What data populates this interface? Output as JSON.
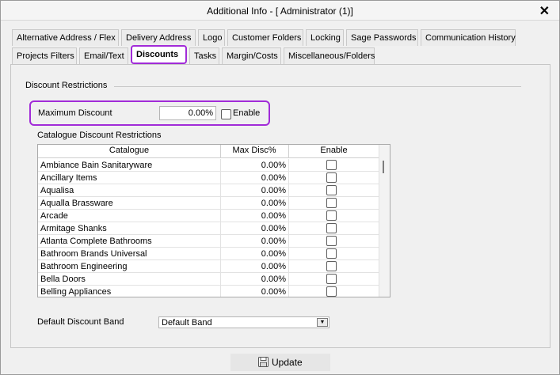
{
  "window": {
    "title": "Additional Info - [ Administrator (1)]",
    "close_glyph": "✕"
  },
  "tabs": {
    "row1": [
      "Alternative Address / Flex",
      "Delivery Address",
      "Logo",
      "Customer Folders",
      "Locking",
      "Sage Passwords",
      "Communication History"
    ],
    "row2": [
      "Projects Filters",
      "Email/Text",
      "Discounts",
      "Tasks",
      "Margin/Costs",
      "Miscellaneous/Folders"
    ],
    "active": "Discounts"
  },
  "discount_restrictions": {
    "group_label": "Discount Restrictions",
    "max_discount_label": "Maximum Discount",
    "max_discount_value": "0.00%",
    "enable_label": "Enable",
    "enable_checked": false
  },
  "catalogue": {
    "label": "Catalogue Discount Restrictions",
    "columns": [
      "Catalogue",
      "Max Disc%",
      "Enable"
    ],
    "rows": [
      {
        "name": "Ambiance Bain Sanitaryware",
        "disc": "0.00%",
        "enabled": false
      },
      {
        "name": "Ancillary Items",
        "disc": "0.00%",
        "enabled": false
      },
      {
        "name": "Aqualisa",
        "disc": "0.00%",
        "enabled": false
      },
      {
        "name": "Aqualla Brassware",
        "disc": "0.00%",
        "enabled": false
      },
      {
        "name": "Arcade",
        "disc": "0.00%",
        "enabled": false
      },
      {
        "name": "Armitage Shanks",
        "disc": "0.00%",
        "enabled": false
      },
      {
        "name": "Atlanta Complete Bathrooms",
        "disc": "0.00%",
        "enabled": false
      },
      {
        "name": "Bathroom Brands Universal",
        "disc": "0.00%",
        "enabled": false
      },
      {
        "name": "Bathroom Engineering",
        "disc": "0.00%",
        "enabled": false
      },
      {
        "name": "Bella Doors",
        "disc": "0.00%",
        "enabled": false
      },
      {
        "name": "Belling Appliances",
        "disc": "0.00%",
        "enabled": false
      }
    ]
  },
  "default_band": {
    "label": "Default Discount Band",
    "value": "Default Band"
  },
  "footer": {
    "update_label": "Update",
    "update_icon": "save-icon"
  },
  "colors": {
    "highlight": "#a12bd8",
    "background": "#f0f0f0"
  }
}
